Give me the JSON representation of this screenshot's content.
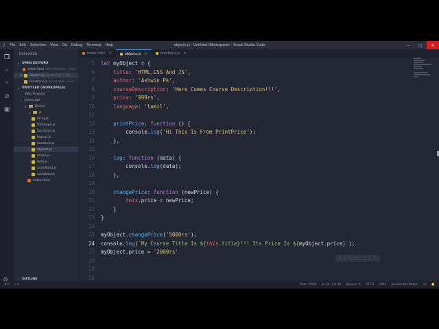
{
  "window": {
    "title": "objects.js - Untitled (Workspace) - Visual Studio Code"
  },
  "menu": [
    "File",
    "Edit",
    "Selection",
    "View",
    "Go",
    "Debug",
    "Terminal",
    "Help"
  ],
  "window_controls": {
    "minimize": "–",
    "maximize": "□",
    "close": "✕"
  },
  "sidebar": {
    "title": "EXPLORER",
    "open_editors_label": "OPEN EDITORS",
    "open_editors": [
      {
        "name": "index.html",
        "detail": "Web Projects • Exe..."
      },
      {
        "name": "objects.js",
        "detail": "Javascript • Exe..."
      },
      {
        "name": "functions.js",
        "detail": "Javascript • Exe..."
      }
    ],
    "workspace_label": "UNTITLED (WORKSPACE)",
    "tree": [
      {
        "name": "Web Projects",
        "kind": "root"
      },
      {
        "name": "Javascript",
        "kind": "root"
      },
      {
        "name": "Basics",
        "kind": "folder"
      },
      {
        "name": "js",
        "kind": "folder"
      },
      {
        "name": "Array.js",
        "kind": "js"
      },
      {
        "name": "Datatype.js",
        "kind": "js"
      },
      {
        "name": "functions.js",
        "kind": "js"
      },
      {
        "name": "logical.js",
        "kind": "js"
      },
      {
        "name": "numbers.js",
        "kind": "js"
      },
      {
        "name": "objects.js",
        "kind": "js"
      },
      {
        "name": "scope.js",
        "kind": "js"
      },
      {
        "name": "todo.js",
        "kind": "js"
      },
      {
        "name": "undefined.js",
        "kind": "js"
      },
      {
        "name": "variables.js",
        "kind": "js"
      },
      {
        "name": "index.html",
        "kind": "html"
      }
    ],
    "outline_label": "OUTLINE"
  },
  "tabs": [
    {
      "label": "index.html",
      "kind": "html",
      "active": false
    },
    {
      "label": "objects.js",
      "kind": "js",
      "active": true
    },
    {
      "label": "functions.js",
      "kind": "js",
      "active": false
    }
  ],
  "editor": {
    "current_line": "24",
    "lines": [
      {
        "n": "5",
        "tokens": [
          [
            "kw",
            "let "
          ],
          [
            "plain",
            "myObject = {"
          ]
        ]
      },
      {
        "n": "6",
        "tokens": [
          [
            "plain",
            "    "
          ],
          [
            "prop",
            "title"
          ],
          [
            "plain",
            ": "
          ],
          [
            "str",
            "'HTML,CSS And JS'"
          ],
          [
            "plain",
            ","
          ]
        ]
      },
      {
        "n": "7",
        "tokens": [
          [
            "plain",
            "    "
          ],
          [
            "prop",
            "author"
          ],
          [
            "plain",
            ": "
          ],
          [
            "str",
            "'Ashwin Pk'"
          ],
          [
            "plain",
            ","
          ]
        ]
      },
      {
        "n": "8",
        "tokens": [
          [
            "plain",
            "    "
          ],
          [
            "prop",
            "courseDescription"
          ],
          [
            "plain",
            ": "
          ],
          [
            "str",
            "'Here Comes Course Description!!!'"
          ],
          [
            "plain",
            ","
          ]
        ]
      },
      {
        "n": "9",
        "tokens": [
          [
            "plain",
            "    "
          ],
          [
            "prop",
            "price"
          ],
          [
            "plain",
            ": "
          ],
          [
            "str",
            "'999rs'"
          ],
          [
            "plain",
            ","
          ]
        ]
      },
      {
        "n": "10",
        "tokens": [
          [
            "plain",
            "    "
          ],
          [
            "prop",
            "language"
          ],
          [
            "plain",
            ": "
          ],
          [
            "str",
            "'tamil'"
          ],
          [
            "plain",
            ","
          ]
        ]
      },
      {
        "n": "11",
        "tokens": []
      },
      {
        "n": "12",
        "tokens": [
          [
            "plain",
            "    "
          ],
          [
            "fn",
            "printPrice"
          ],
          [
            "plain",
            ": "
          ],
          [
            "kw",
            "function"
          ],
          [
            "plain",
            " () {"
          ]
        ]
      },
      {
        "n": "13",
        "tokens": [
          [
            "plain",
            "        console."
          ],
          [
            "fn",
            "log"
          ],
          [
            "plain",
            "("
          ],
          [
            "str",
            "'Hi This Is From PrintPrice'"
          ],
          [
            "plain",
            ");"
          ]
        ]
      },
      {
        "n": "14",
        "tokens": [
          [
            "plain",
            "    },"
          ]
        ]
      },
      {
        "n": "15",
        "tokens": []
      },
      {
        "n": "16",
        "tokens": [
          [
            "plain",
            "    "
          ],
          [
            "fn",
            "log"
          ],
          [
            "plain",
            ": "
          ],
          [
            "kw",
            "function"
          ],
          [
            "plain",
            " (data) {"
          ]
        ]
      },
      {
        "n": "17",
        "tokens": [
          [
            "plain",
            "        console."
          ],
          [
            "fn",
            "log"
          ],
          [
            "plain",
            "(data);"
          ]
        ]
      },
      {
        "n": "18",
        "tokens": [
          [
            "plain",
            "    },"
          ]
        ]
      },
      {
        "n": "19",
        "tokens": []
      },
      {
        "n": "20",
        "tokens": [
          [
            "plain",
            "    "
          ],
          [
            "fn",
            "changePrice"
          ],
          [
            "plain",
            ": "
          ],
          [
            "kw",
            "function"
          ],
          [
            "plain",
            " (newPrice) {"
          ]
        ]
      },
      {
        "n": "21",
        "tokens": [
          [
            "plain",
            "        "
          ],
          [
            "this",
            "this"
          ],
          [
            "plain",
            ".price = newPrice;"
          ]
        ]
      },
      {
        "n": "22",
        "tokens": [
          [
            "plain",
            "    }"
          ]
        ]
      },
      {
        "n": "23",
        "tokens": [
          [
            "plain",
            "}"
          ]
        ]
      },
      {
        "n": "24",
        "tokens": []
      },
      {
        "n": "25",
        "tokens": [
          [
            "plain",
            "myObject."
          ],
          [
            "fn",
            "changePrice"
          ],
          [
            "plain",
            "("
          ],
          [
            "str",
            "'5000rs'"
          ],
          [
            "plain",
            ");"
          ]
        ]
      },
      {
        "n": "24",
        "tokens": [
          [
            "plain",
            "console."
          ],
          [
            "fn",
            "log"
          ],
          [
            "plain",
            "("
          ],
          [
            "tpl",
            "`My Course Title Is ${"
          ],
          [
            "this",
            "this"
          ],
          [
            "tpl",
            ".title}!!! Its Price Is ${"
          ],
          [
            "plain",
            "myObject.price"
          ],
          [
            "tpl",
            "}`"
          ],
          [
            "plain",
            ");"
          ]
        ]
      },
      {
        "n": "27",
        "tokens": [
          [
            "plain",
            "myObject.price = "
          ],
          [
            "str",
            "'2000rs'"
          ]
        ]
      },
      {
        "n": "28",
        "tokens": []
      },
      {
        "n": "29",
        "tokens": []
      },
      {
        "n": "30",
        "tokens": []
      }
    ]
  },
  "watermark": "BRANCHEY",
  "statusbar": {
    "left": [
      "⊗ 0",
      "⚠ 0"
    ],
    "right": [
      "Ln 24, Col 36",
      "Spaces: 4",
      "UTF-8",
      "CRLF",
      "JavaScript (Babel)",
      "☺",
      "🔔"
    ],
    "port": "Port : 5500"
  },
  "colors": {
    "editor_bg": "#232733",
    "keyword": "#c178dd",
    "property": "#e06c75",
    "string": "#e5c07b",
    "function": "#61afef",
    "template": "#98c379",
    "close_button": "#d71d20"
  }
}
